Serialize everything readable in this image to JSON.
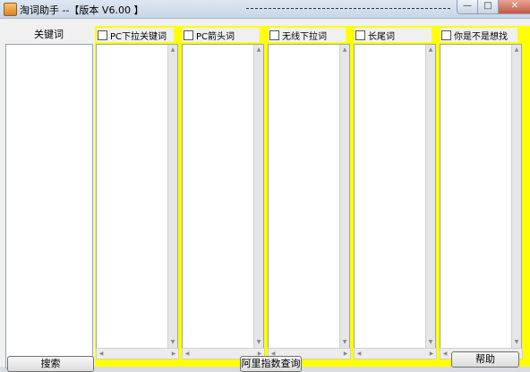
{
  "window": {
    "title": "淘词助手 --【版本 V6.00 】",
    "minimize": "—",
    "maximize": "□",
    "close": "✕"
  },
  "keyword_column": {
    "header": "关键词"
  },
  "columns": [
    {
      "label": "PC下拉关键词"
    },
    {
      "label": "PC箭头词"
    },
    {
      "label": "无线下拉词"
    },
    {
      "label": "长尾词"
    },
    {
      "label": "你是不是想找"
    }
  ],
  "buttons": {
    "search": "搜索",
    "alibaba_index": "阿里指数查询",
    "help": "帮助"
  },
  "colors": {
    "highlight": "#ffff00"
  },
  "icons": {
    "scroll_up": "triangle-up",
    "scroll_down": "triangle-down",
    "scroll_left": "triangle-left",
    "scroll_right": "triangle-right"
  }
}
